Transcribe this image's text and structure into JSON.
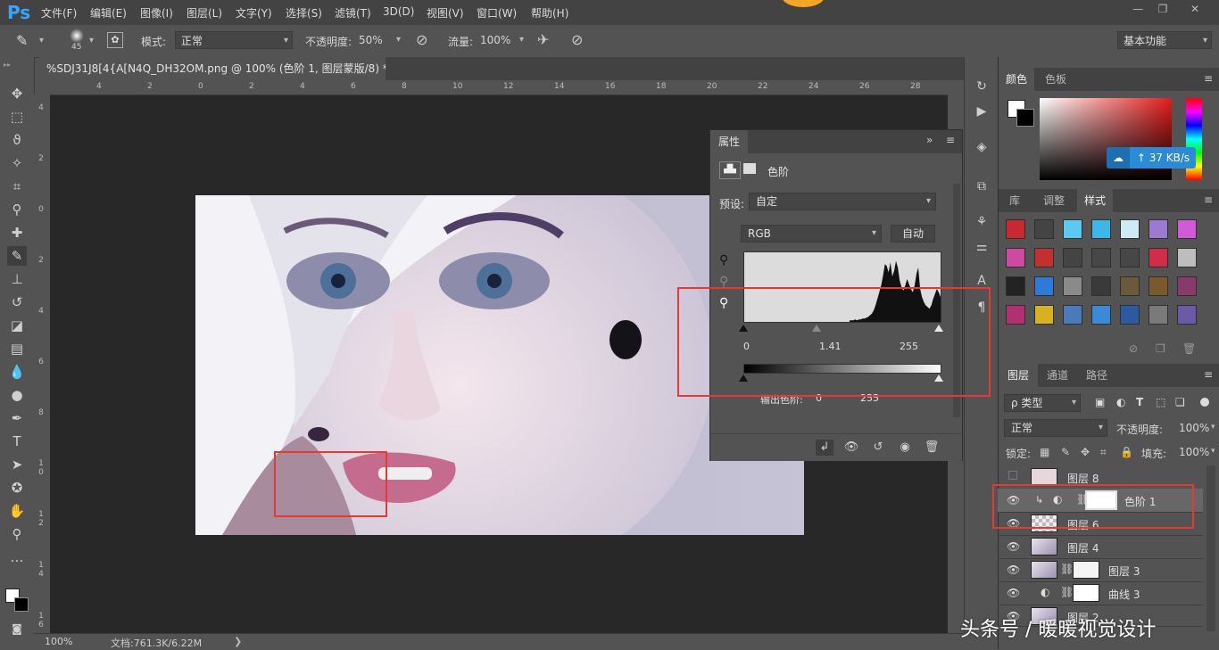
{
  "menubar": {
    "logo": "Ps",
    "items": [
      "文件(F)",
      "编辑(E)",
      "图像(I)",
      "图层(L)",
      "文字(Y)",
      "选择(S)",
      "滤镜(T)",
      "3D(D)",
      "视图(V)",
      "窗口(W)",
      "帮助(H)"
    ],
    "window_controls": [
      "—",
      "❐",
      "✕"
    ]
  },
  "options": {
    "brush_size": "45",
    "mode_label": "模式:",
    "mode_value": "正常",
    "opacity_label": "不透明度:",
    "opacity_value": "50%",
    "flow_label": "流量:",
    "flow_value": "100%",
    "workspace": "基本功能"
  },
  "document": {
    "tab_title": "%SDJ31J8[4{A[N4Q_DH32OM.png @ 100% (色阶 1, 图层蒙版/8) *",
    "close": "×",
    "zoom": "100%",
    "doc_info": "文档:761.3K/6.22M",
    "status_arrow": "❯"
  },
  "ruler": {
    "h_labels": [
      "4",
      "2",
      "0",
      "2",
      "4",
      "6",
      "8",
      "10",
      "12",
      "14",
      "16",
      "18",
      "20",
      "22",
      "24",
      "26",
      "28"
    ],
    "v_labels": [
      "4",
      "2",
      "0",
      "2",
      "4",
      "6",
      "8",
      "10",
      "12",
      "14",
      "16"
    ]
  },
  "properties": {
    "tab": "属性",
    "expand": "»",
    "menu": "≡",
    "adjustment_name": "色阶",
    "preset_label": "预设:",
    "preset_value": "自定",
    "channel": "RGB",
    "auto_button": "自动",
    "input_levels": {
      "black": "0",
      "gamma": "1.41",
      "white": "255"
    },
    "output_label": "输出色阶:",
    "output_levels": {
      "black": "0",
      "white": "255"
    },
    "histogram_shape": [
      2,
      2,
      2,
      3,
      2,
      3,
      3,
      4,
      4,
      5,
      6,
      8,
      10,
      14,
      20,
      28,
      36,
      44,
      56,
      70,
      68,
      60,
      72,
      55,
      62,
      74,
      66,
      50,
      42,
      38,
      44,
      52,
      46,
      40,
      36,
      44,
      58,
      66,
      40,
      30,
      24,
      20,
      18,
      16,
      20,
      28,
      34,
      40,
      36,
      30
    ]
  },
  "color_panel": {
    "tabs": [
      "颜色",
      "色板"
    ],
    "menu": "≡"
  },
  "net_speed": "↑ 37 KB/s",
  "styles_panel": {
    "tabs": [
      "库",
      "调整",
      "样式"
    ],
    "menu": "≡",
    "swatch_colors": [
      [
        "#c8282f",
        "#444444",
        "#5bc9f0",
        "#3db6e8",
        "#cfe9f5",
        "#9b7bd0",
        "#d05ad8"
      ],
      [
        "#ce4aa0",
        "#c23030",
        "#444444",
        "#474747",
        "#474747",
        "#d02d4a",
        "#bdbdbd"
      ],
      [
        "#232323",
        "#2e7ad8",
        "#8a8a8a",
        "#3a3a3a",
        "#6a5a3a",
        "#7a5a2a",
        "#8a3a6a"
      ],
      [
        "#b03070",
        "#d8b020",
        "#4a7ab8",
        "#3a8ad8",
        "#2c5aa0",
        "#7a7a7a",
        "#6a5aa8"
      ]
    ]
  },
  "layers_panel": {
    "tabs": [
      "图层",
      "通道",
      "路径"
    ],
    "menu": "≡",
    "filter_label": "ρ 类型",
    "blend_mode": "正常",
    "opacity_label": "不透明度:",
    "opacity_value": "100%",
    "lock_label": "锁定:",
    "fill_label": "填充:",
    "fill_value": "100%",
    "layers": [
      {
        "name": "图层 8",
        "visible": false,
        "selected": false
      },
      {
        "name": "色阶 1",
        "visible": true,
        "selected": true
      },
      {
        "name": "图层 6",
        "visible": true,
        "selected": false
      },
      {
        "name": "图层 4",
        "visible": true,
        "selected": false
      },
      {
        "name": "图层 3",
        "visible": true,
        "selected": false
      },
      {
        "name": "曲线 3",
        "visible": true,
        "selected": false
      },
      {
        "name": "图层 2",
        "visible": true,
        "selected": false
      }
    ]
  },
  "watermark": "头条号 / 暖暖视觉设计",
  "colors": {
    "accent": "#31a8ff",
    "annotation": "#e53935",
    "panel_bg": "#535353",
    "canvas_bg": "#282828"
  }
}
